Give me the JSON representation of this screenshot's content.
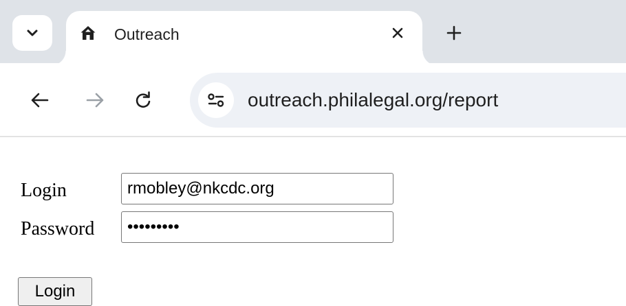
{
  "browser": {
    "tab": {
      "title": "Outreach",
      "favicon": "home-icon"
    },
    "address_bar": {
      "url": "outreach.philalegal.org/report"
    },
    "icons": {
      "tab_list": "chevron-down-icon",
      "close_tab": "close-icon",
      "new_tab": "plus-icon",
      "back": "back-arrow-icon",
      "forward": "forward-arrow-icon",
      "reload": "reload-icon",
      "site_info": "tune-icon"
    }
  },
  "form": {
    "login_label": "Login",
    "login_value": "rmobley@nkcdc.org",
    "password_label": "Password",
    "password_value": "•••••••••",
    "submit_label": "Login"
  },
  "colors": {
    "tabstrip_bg": "#dfe3e8",
    "omnibox_bg": "#eef1f6",
    "forward_disabled": "#9aa0a6"
  }
}
